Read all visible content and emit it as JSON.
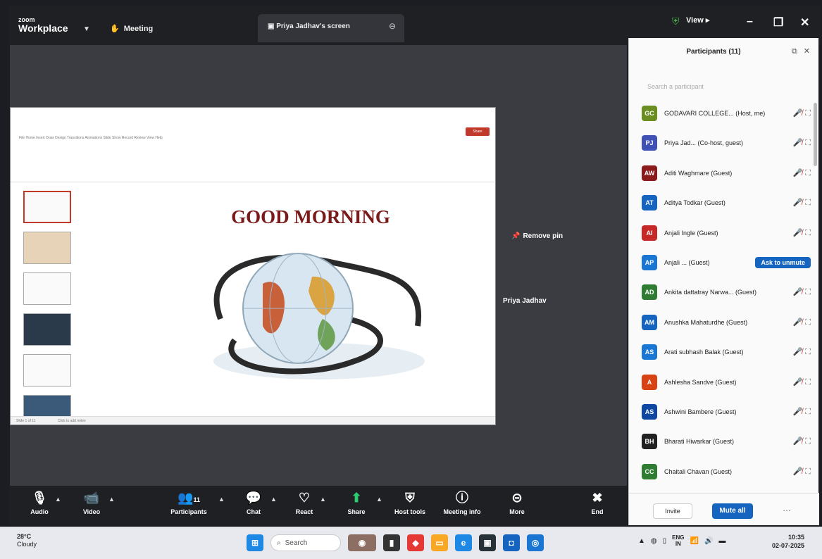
{
  "window": {
    "app_name_line1": "zoom",
    "app_name_line2": "Workplace",
    "meeting_label": "Meeting",
    "share_tab_label": "Priya Jadhav's screen",
    "view_label": "View",
    "minimize": "–",
    "maximize": "❐",
    "close": "✕"
  },
  "shared_screen": {
    "ppt_menu": "File   Home   Insert   Draw   Design   Transitions   Animations   Slide Show   Record   Review   View   Help",
    "share_button": "Share",
    "slide_title": "GOOD MORNING",
    "status_left": "Slide 1 of 11",
    "notes_hint": "Click to add notes"
  },
  "stage": {
    "remove_pin_label": "Remove pin",
    "presenter_name": "Priya Jadhav"
  },
  "toolbar": {
    "audio": "Audio",
    "video": "Video",
    "participants": "Participants",
    "participants_count": "11",
    "chat": "Chat",
    "react": "React",
    "share": "Share",
    "host_tools": "Host tools",
    "meeting_info": "Meeting info",
    "more": "More",
    "end": "End"
  },
  "participants_panel": {
    "title": "Participants (11)",
    "search_placeholder": "Search a participant",
    "ask_to_unmute": "Ask to unmute",
    "invite": "Invite",
    "mute_all": "Mute all",
    "participants": [
      {
        "initials": "GC",
        "name": "GODAVARI COLLEGE... (Host, me)",
        "color": "#6b8e23"
      },
      {
        "initials": "PJ",
        "name": "Priya Jad... (Co-host, guest)",
        "color": "#3f51b5"
      },
      {
        "initials": "AW",
        "name": "Aditi Waghmare (Guest)",
        "color": "#8b1a1a"
      },
      {
        "initials": "AT",
        "name": "Aditya Todkar (Guest)",
        "color": "#1565c0"
      },
      {
        "initials": "AI",
        "name": "Anjali Ingle (Guest)",
        "color": "#c62828"
      },
      {
        "initials": "AP",
        "name": "Anjali ... (Guest)",
        "color": "#1976d2"
      },
      {
        "initials": "AD",
        "name": "Ankita dattatray Narwa... (Guest)",
        "color": "#2e7d32"
      },
      {
        "initials": "AM",
        "name": "Anushka Mahaturdhe (Guest)",
        "color": "#1565c0"
      },
      {
        "initials": "AS",
        "name": "Arati subhash Balak (Guest)",
        "color": "#1976d2"
      },
      {
        "initials": "A",
        "name": "Ashlesha Sandve (Guest)",
        "color": "#d84315"
      },
      {
        "initials": "AS",
        "name": "Ashwini Bambere (Guest)",
        "color": "#0d47a1"
      },
      {
        "initials": "BH",
        "name": "Bharati Hiwarkar (Guest)",
        "color": "#212121"
      },
      {
        "initials": "CC",
        "name": "Chaitali Chavan (Guest)",
        "color": "#2e7d32"
      }
    ]
  },
  "taskbar": {
    "temperature": "28°C",
    "weather": "Cloudy",
    "search": "Search",
    "lang1": "ENG",
    "lang2": "IN",
    "time": "10:35",
    "date": "02-07-2025"
  }
}
